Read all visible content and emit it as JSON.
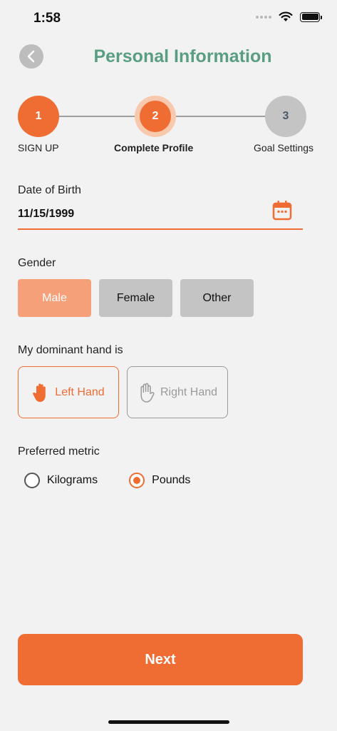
{
  "status_bar": {
    "time": "1:58"
  },
  "header": {
    "title": "Personal Information"
  },
  "stepper": {
    "steps": [
      {
        "number": "1",
        "label": "SIGN UP",
        "state": "done"
      },
      {
        "number": "2",
        "label": "Complete Profile",
        "state": "current"
      },
      {
        "number": "3",
        "label": "Goal Settings",
        "state": "pending"
      }
    ]
  },
  "dob": {
    "label": "Date of Birth",
    "value": "11/15/1999"
  },
  "gender": {
    "label": "Gender",
    "options": [
      "Male",
      "Female",
      "Other"
    ],
    "selected": "Male"
  },
  "dominant_hand": {
    "label": "My dominant hand is",
    "options": [
      "Left Hand",
      "Right Hand"
    ],
    "selected": "Left Hand"
  },
  "metric": {
    "label": "Preferred metric",
    "options": [
      "Kilograms",
      "Pounds"
    ],
    "selected": "Pounds"
  },
  "actions": {
    "next_label": "Next"
  },
  "colors": {
    "accent": "#ef6c33",
    "title": "#5a9e82",
    "selected_gender": "#f6a07a"
  }
}
